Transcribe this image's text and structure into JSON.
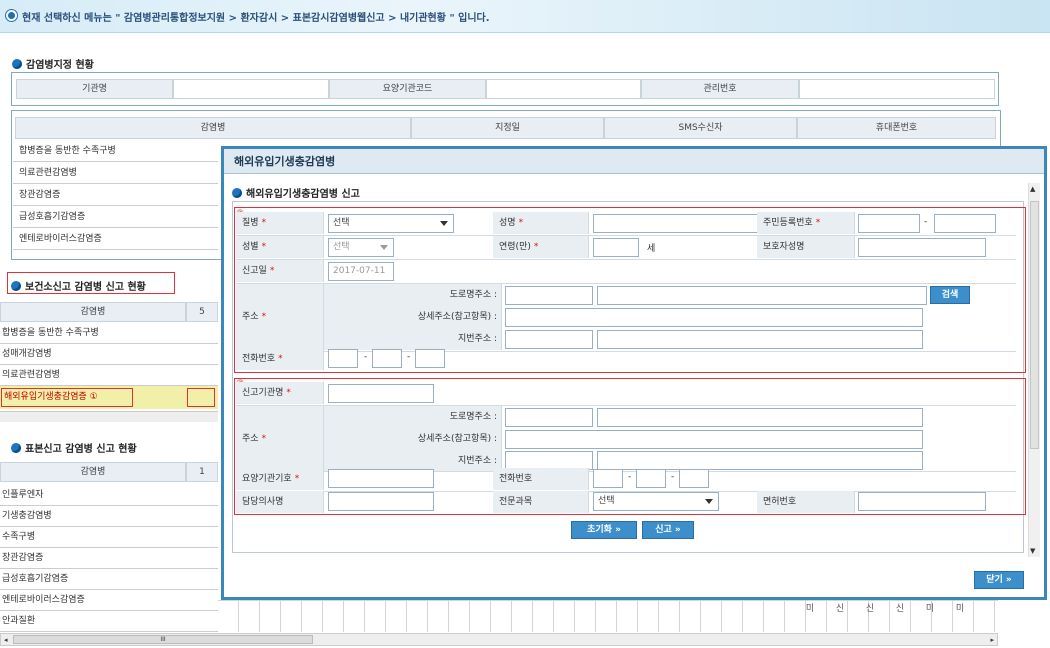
{
  "topbar": {
    "text": "현재 선택하신 메뉴는 \" 감염병관리통합정보지원 > 환자감시 > 표본감시감염병웹신고 > 내기관현황 \" 입니다."
  },
  "designation": {
    "title": "감염병지정 현황",
    "header": [
      "기관명",
      "요양기관코드",
      "관리번호"
    ],
    "table_headers": [
      "감염병",
      "지정일",
      "SMS수신자",
      "휴대폰번호"
    ],
    "rows": [
      "합병증을 동반한 수족구병",
      "의료관련감염병",
      "장관감염증",
      "급성호흡기감염증",
      "엔테로바이러스감염증"
    ]
  },
  "health_center": {
    "title": "보건소신고 감염병 신고 현황",
    "col_header": "감염병",
    "col_num": "5",
    "rows": [
      "합병증을 동반한 수족구병",
      "성매개감염병",
      "의료관련감염병",
      "해외유입기생충감염증 ①"
    ]
  },
  "sample": {
    "title": "표본신고 감염병 신고 현황",
    "col_header": "감염병",
    "col_num": "1",
    "rows": [
      "인플루엔자",
      "기생충감염병",
      "수족구병",
      "장관감염증",
      "급성호흡기감염증",
      "엔테로바이러스감염증",
      "안과질환"
    ],
    "bg_cells": [
      "미",
      "신",
      "신",
      "신",
      "미",
      "미"
    ],
    "scroll_mid": "III"
  },
  "modal": {
    "title": "해외유입기생충감염병",
    "subtitle": "해외유입기생충감염병 신고",
    "marker2": "②",
    "marker3": "③",
    "patient": {
      "disease_label": "질병",
      "disease_value": "선택",
      "name_label": "성명",
      "rrn_label": "주민등록번호",
      "rrn_sep": "-",
      "sex_label": "성별",
      "sex_value": "선택",
      "age_label": "연령(만)",
      "age_unit": "세",
      "guardian_label": "보호자성명",
      "report_date_label": "신고일",
      "report_date_value": "2017-07-11",
      "address_label": "주소",
      "road_label": "도로명주소 :",
      "detail_label": "상세주소(참고항목) :",
      "lot_label": "지번주소 :",
      "search_btn": "검색",
      "phone_label": "전화번호",
      "phone_sep": "-"
    },
    "agency": {
      "agency_label": "신고기관명",
      "address_label": "주소",
      "road_label": "도로명주소 :",
      "detail_label": "상세주소(참고항목) :",
      "lot_label": "지번주소 :",
      "code_label": "요양기관기호",
      "phone_label": "전화번호",
      "phone_sep": "-",
      "doctor_label": "담당의사명",
      "specialty_label": "전문과목",
      "specialty_value": "선택",
      "license_label": "면허번호"
    },
    "reset_btn": "초기화 »",
    "submit_btn": "신고 »",
    "close_btn": "닫기 »"
  },
  "colors": {
    "accent": "#3d8fcc",
    "required": "#d11111",
    "highlight": "#e0303a"
  }
}
